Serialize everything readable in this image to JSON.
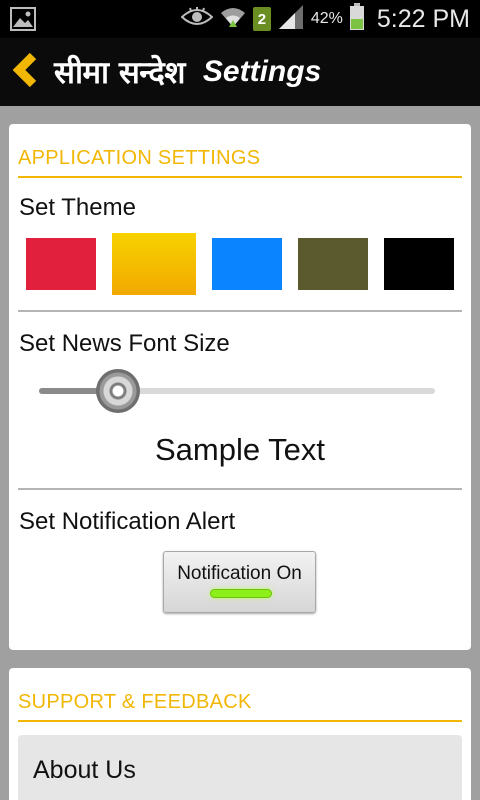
{
  "status_bar": {
    "notification_count": "2",
    "battery_percent": "42%",
    "time": "5:22 PM",
    "icons": [
      "gallery-icon",
      "eye-icon",
      "wifi-icon",
      "signal-icon",
      "battery-icon"
    ]
  },
  "app_bar": {
    "brand": "सीमा सन्देश",
    "title": "Settings",
    "back_icon": "chevron-left-icon",
    "accent": "#f2b705"
  },
  "app_settings": {
    "section_title": "APPLICATION SETTINGS",
    "theme_label": "Set Theme",
    "themes": [
      {
        "color": "#e0203c",
        "selected": false
      },
      {
        "color": "#f2a900",
        "selected": true
      },
      {
        "color": "#0a84ff",
        "selected": false
      },
      {
        "color": "#5a5a2e",
        "selected": false
      },
      {
        "color": "#000000",
        "selected": false
      }
    ],
    "font_size_label": "Set News Font Size",
    "font_size_level": 0.2,
    "sample_text": "Sample Text",
    "notification_label": "Set Notification Alert",
    "notification_button": "Notification On",
    "notification_state": "on"
  },
  "support": {
    "section_title": "SUPPORT & FEEDBACK",
    "items": [
      {
        "label": "About Us"
      }
    ]
  }
}
